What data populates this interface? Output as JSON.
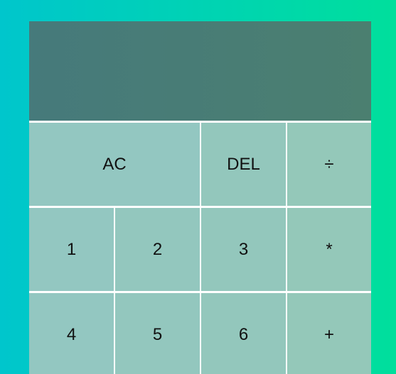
{
  "display": {
    "previous_operand": "",
    "current_operand": ""
  },
  "buttons": {
    "ac": "AC",
    "del": "DEL",
    "divide": "÷",
    "one": "1",
    "two": "2",
    "three": "3",
    "multiply": "*",
    "four": "4",
    "five": "5",
    "six": "6",
    "add": "+"
  },
  "colors": {
    "background_left": "#00c6cc",
    "background_right": "#00df9c",
    "display_bg": "#477c76",
    "button_bg": "#93c6bf",
    "button_text": "#111111"
  }
}
